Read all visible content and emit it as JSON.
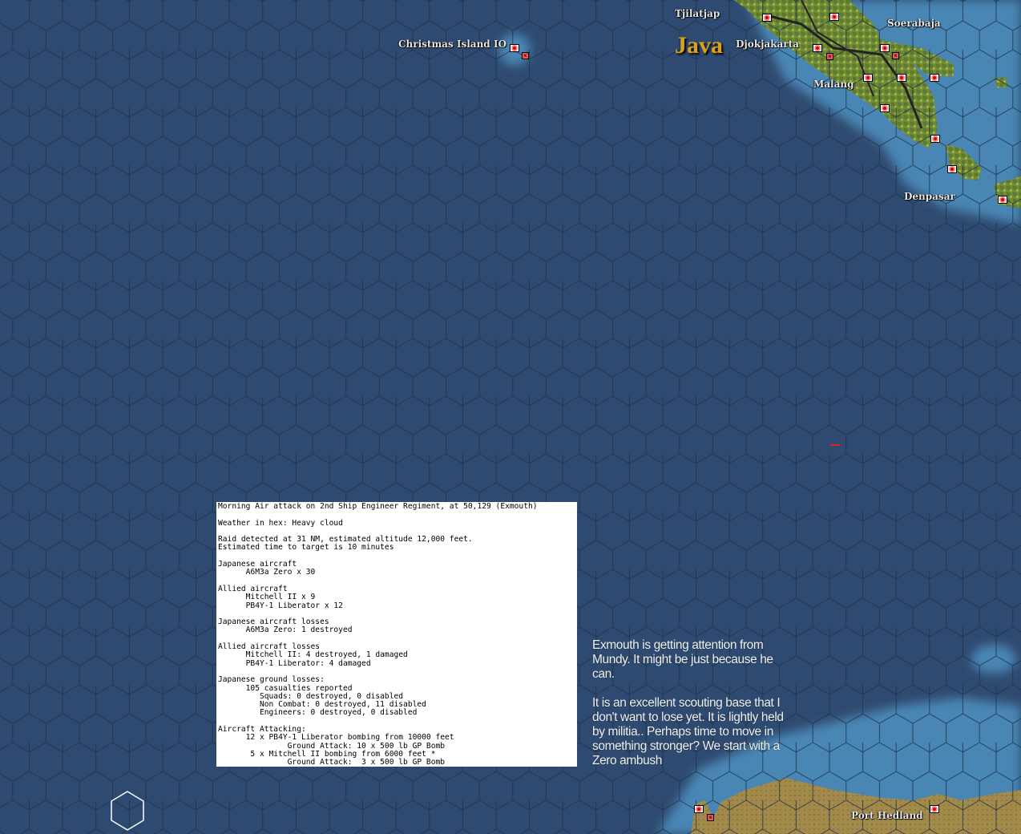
{
  "map": {
    "region_label": "Java",
    "place_labels": {
      "tjilatjap": "Tjilatjap",
      "christmas_island": "Christmas Island IO",
      "djokjakarta": "Djokjakarta",
      "soerabaja": "Soerabaja",
      "malang": "Malang",
      "denpasar": "Denpasar",
      "port_hedland": "Port Hedland"
    },
    "colors": {
      "deep_sea": "#2f4a70",
      "shallow_sea": "#4a86b4",
      "land_java": "#7a8a3a",
      "land_australia": "#a08a48",
      "flag": "#d00000"
    }
  },
  "combat_report": {
    "lines": [
      "Morning Air attack on 2nd Ship Engineer Regiment, at 50,129 (Exmouth)",
      "",
      "Weather in hex: Heavy cloud",
      "",
      "Raid detected at 31 NM, estimated altitude 12,000 feet.",
      "Estimated time to target is 10 minutes",
      "",
      "Japanese aircraft",
      "      A6M3a Zero x 30",
      "",
      "Allied aircraft",
      "      Mitchell II x 9",
      "      PB4Y-1 Liberator x 12",
      "",
      "Japanese aircraft losses",
      "      A6M3a Zero: 1 destroyed",
      "",
      "Allied aircraft losses",
      "      Mitchell II: 4 destroyed, 1 damaged",
      "      PB4Y-1 Liberator: 4 damaged",
      "",
      "Japanese ground losses:",
      "      105 casualties reported",
      "         Squads: 0 destroyed, 0 disabled",
      "         Non Combat: 0 destroyed, 11 disabled",
      "         Engineers: 0 destroyed, 0 disabled",
      "",
      "Aircraft Attacking:",
      "      12 x PB4Y-1 Liberator bombing from 10000 feet",
      "               Ground Attack: 10 x 500 lb GP Bomb",
      "       5 x Mitchell II bombing from 6000 feet *",
      "               Ground Attack:  3 x 500 lb GP Bomb"
    ]
  },
  "commentary": {
    "paragraph_1": "Exmouth is getting attention from Mundy. It might be just because he can.",
    "paragraph_2": "It is an excellent scouting base that I don't want to lose yet. It is lightly held by militia.. Perhaps time to move in something stronger? We start with a Zero ambush"
  }
}
